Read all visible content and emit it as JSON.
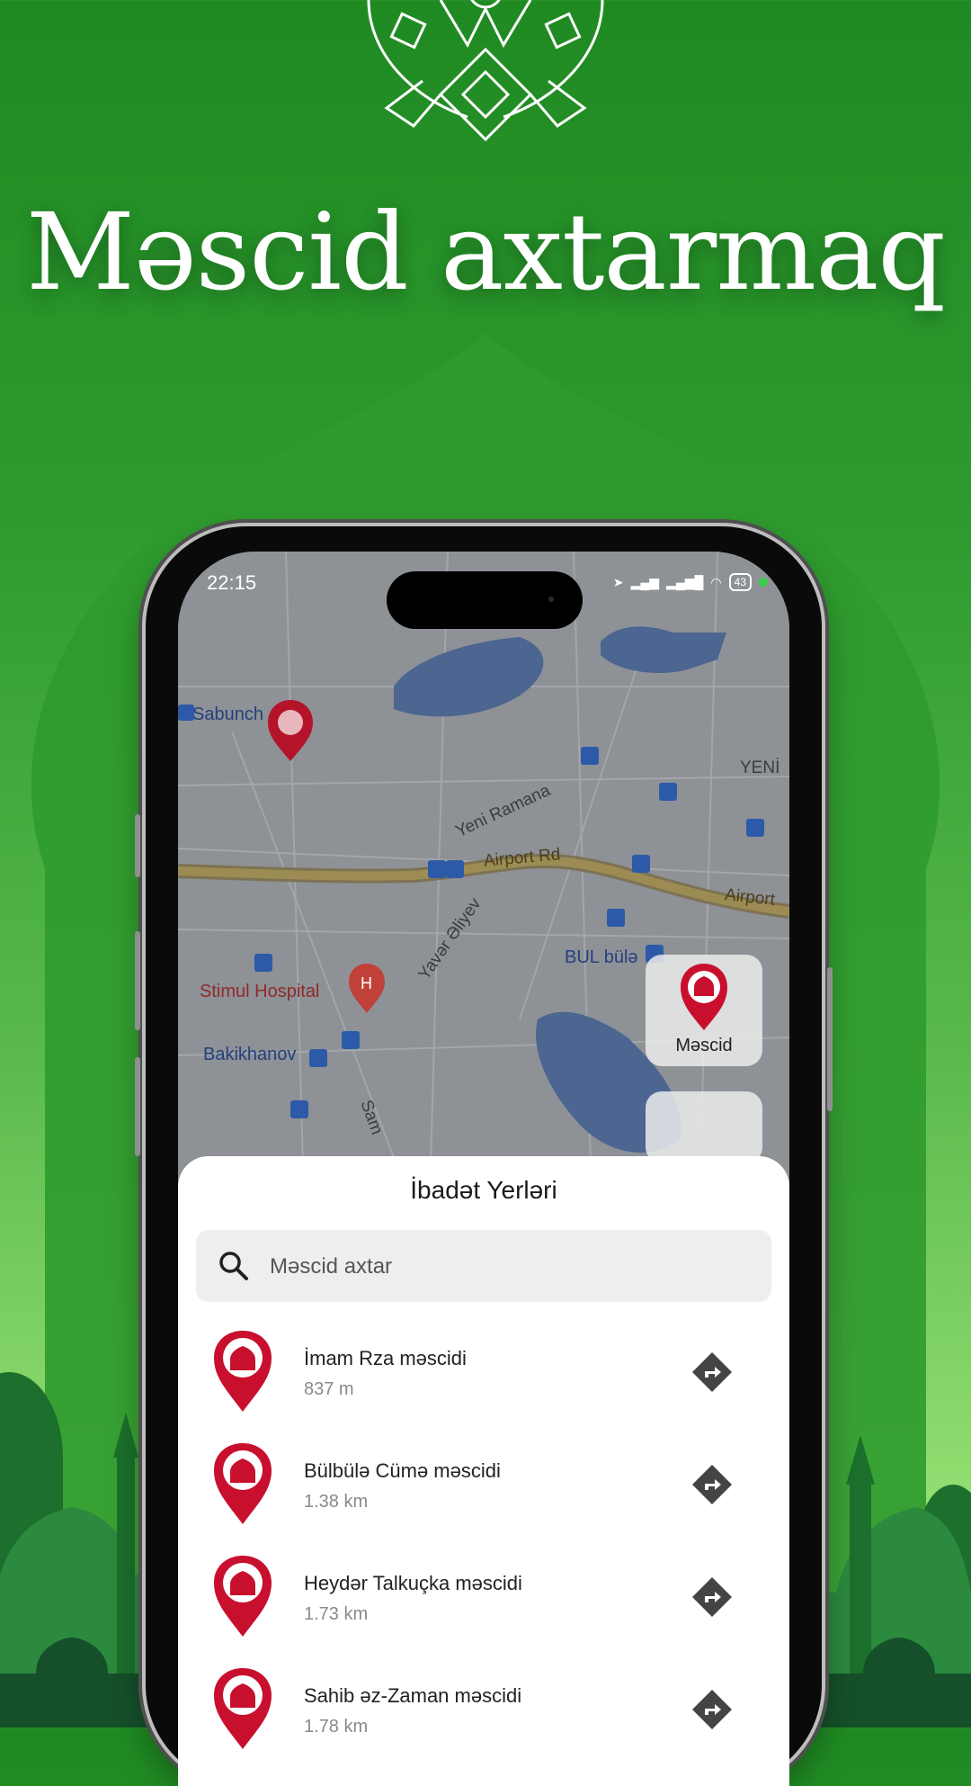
{
  "headline": "Məscid axtarmaq",
  "status": {
    "time": "22:15",
    "battery": "43"
  },
  "map": {
    "labels": {
      "sabunchu": "Sabunch",
      "yeni_ramana": "Yeni Ramana",
      "yeni": "YENİ",
      "airport_rd": "Airport Rd",
      "airport": "Airport",
      "yavar_aliyev": "Yavər Əliyev",
      "bul_bula": "BUL bülə",
      "stimul_hospital": "Stimul Hospital",
      "bakikhanov": "Bakikhanov",
      "sama": "Sam"
    }
  },
  "fab": {
    "label": "Məscid"
  },
  "sheet": {
    "title": "İbadət Yerləri",
    "search_placeholder": "Məscid axtar",
    "items": [
      {
        "name": "İmam Rza məscidi",
        "distance": "837 m"
      },
      {
        "name": "Bülbülə Cümə məscidi",
        "distance": "1.38 km"
      },
      {
        "name": "Heydər Talkuçka məscidi",
        "distance": "1.73 km"
      },
      {
        "name": "Sahib əz-Zaman məscidi",
        "distance": "1.78 km"
      }
    ]
  },
  "colors": {
    "accent_green": "#2d9a2f",
    "pin_red": "#c8102e",
    "sheet_bg": "#ffffff"
  },
  "icons": [
    "ornament-icon",
    "mosque-pin-icon",
    "search-icon",
    "directions-icon",
    "bus-stop-icon",
    "hospital-icon"
  ]
}
